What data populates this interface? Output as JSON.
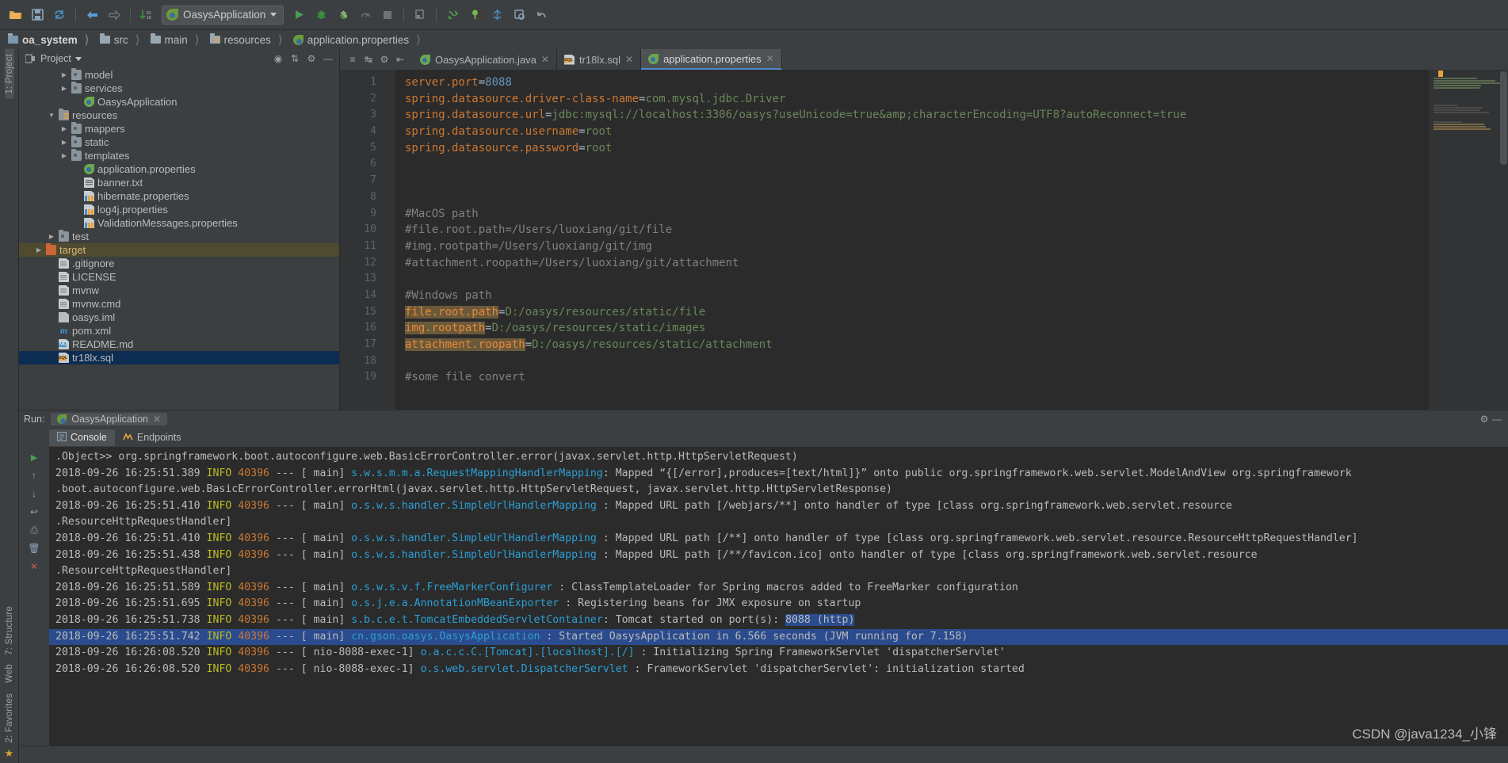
{
  "toolbar": {
    "icons": [
      "open-folder-icon",
      "save-icon",
      "sync-icon",
      "back-arrow-icon",
      "forward-arrow-icon",
      "update-icon"
    ],
    "run_config": "OasysApplication",
    "right_icons": [
      "run-icon",
      "debug-icon",
      "run-coverage-icon",
      "profile-icon",
      "stop-icon",
      "build-icon",
      "vcs-update-icon",
      "vcs-commit-icon",
      "vcs-merge-icon",
      "search-everywhere-icon",
      "settings-icon",
      "undo-icon"
    ]
  },
  "breadcrumb": [
    "oa_system",
    "src",
    "main",
    "resources",
    "application.properties"
  ],
  "project_panel": {
    "title": "Project",
    "tools": [
      "target-icon",
      "collapse-icon",
      "settings-icon",
      "hide-icon"
    ],
    "items": [
      {
        "label": "model",
        "indent": 3,
        "arrow": "▶",
        "icon": "folder-icon"
      },
      {
        "label": "services",
        "indent": 3,
        "arrow": "▶",
        "icon": "folder-icon"
      },
      {
        "label": "OasysApplication",
        "indent": 4,
        "arrow": "",
        "icon": "spring-class-icon"
      },
      {
        "label": "resources",
        "indent": 2,
        "arrow": "▼",
        "icon": "resources-folder-icon"
      },
      {
        "label": "mappers",
        "indent": 3,
        "arrow": "▶",
        "icon": "folder-icon"
      },
      {
        "label": "static",
        "indent": 3,
        "arrow": "▶",
        "icon": "folder-icon"
      },
      {
        "label": "templates",
        "indent": 3,
        "arrow": "▶",
        "icon": "folder-icon"
      },
      {
        "label": "application.properties",
        "indent": 4,
        "arrow": "",
        "icon": "spring-properties-icon"
      },
      {
        "label": "banner.txt",
        "indent": 4,
        "arrow": "",
        "icon": "text-file-icon"
      },
      {
        "label": "hibernate.properties",
        "indent": 4,
        "arrow": "",
        "icon": "properties-file-icon"
      },
      {
        "label": "log4j.properties",
        "indent": 4,
        "arrow": "",
        "icon": "properties-file-icon"
      },
      {
        "label": "ValidationMessages.properties",
        "indent": 4,
        "arrow": "",
        "icon": "properties-file-icon"
      },
      {
        "label": "test",
        "indent": 2,
        "arrow": "▶",
        "icon": "folder-icon"
      },
      {
        "label": "target",
        "indent": 1,
        "arrow": "▶",
        "icon": "target-folder-icon",
        "state": "highlighted"
      },
      {
        "label": ".gitignore",
        "indent": 2,
        "arrow": "",
        "icon": "file-icon"
      },
      {
        "label": "LICENSE",
        "indent": 2,
        "arrow": "",
        "icon": "file-icon"
      },
      {
        "label": "mvnw",
        "indent": 2,
        "arrow": "",
        "icon": "file-icon"
      },
      {
        "label": "mvnw.cmd",
        "indent": 2,
        "arrow": "",
        "icon": "file-icon"
      },
      {
        "label": "oasys.iml",
        "indent": 2,
        "arrow": "",
        "icon": "iml-file-icon"
      },
      {
        "label": "pom.xml",
        "indent": 2,
        "arrow": "",
        "icon": "maven-file-icon"
      },
      {
        "label": "README.md",
        "indent": 2,
        "arrow": "",
        "icon": "markdown-file-icon"
      },
      {
        "label": "tr18lx.sql",
        "indent": 2,
        "arrow": "",
        "icon": "sql-file-icon",
        "state": "selected"
      }
    ]
  },
  "editor": {
    "tabs": [
      {
        "label": "OasysApplication.java",
        "icon": "spring-class-icon",
        "active": false,
        "closable": true
      },
      {
        "label": "tr18lx.sql",
        "icon": "sql-file-icon",
        "active": false,
        "closable": true
      },
      {
        "label": "application.properties",
        "icon": "spring-properties-icon",
        "active": true,
        "closable": true
      }
    ],
    "lines": [
      {
        "no": 1,
        "parts": [
          {
            "t": "server.port",
            "c": "k"
          },
          {
            "t": "=",
            "c": "eq"
          },
          {
            "t": "8088",
            "c": "n"
          }
        ]
      },
      {
        "no": 2,
        "parts": [
          {
            "t": "spring.datasource.driver-class-name",
            "c": "k"
          },
          {
            "t": "=",
            "c": "eq"
          },
          {
            "t": "com.mysql.jdbc.Driver",
            "c": "v"
          }
        ]
      },
      {
        "no": 3,
        "parts": [
          {
            "t": "spring.datasource.url",
            "c": "k"
          },
          {
            "t": "=",
            "c": "eq"
          },
          {
            "t": "jdbc:mysql://localhost:3306/oasys?useUnicode=true&amp;characterEncoding=UTF8?autoReconnect=true",
            "c": "v"
          }
        ]
      },
      {
        "no": 4,
        "parts": [
          {
            "t": "spring.datasource.username",
            "c": "k"
          },
          {
            "t": "=",
            "c": "eq"
          },
          {
            "t": "root",
            "c": "v"
          }
        ]
      },
      {
        "no": 5,
        "parts": [
          {
            "t": "spring.datasource.password",
            "c": "k"
          },
          {
            "t": "=",
            "c": "eq"
          },
          {
            "t": "root",
            "c": "v"
          }
        ]
      },
      {
        "no": 6,
        "parts": []
      },
      {
        "no": 7,
        "parts": []
      },
      {
        "no": 8,
        "parts": []
      },
      {
        "no": 9,
        "parts": [
          {
            "t": "#MacOS path",
            "c": "cm"
          }
        ]
      },
      {
        "no": 10,
        "parts": [
          {
            "t": "#file.root.path=/Users/luoxiang/git/file",
            "c": "cm"
          }
        ]
      },
      {
        "no": 11,
        "parts": [
          {
            "t": "#img.rootpath=/Users/luoxiang/git/img",
            "c": "cm"
          }
        ]
      },
      {
        "no": 12,
        "parts": [
          {
            "t": "#attachment.roopath=/Users/luoxiang/git/attachment",
            "c": "cm"
          }
        ]
      },
      {
        "no": 13,
        "parts": []
      },
      {
        "no": 14,
        "parts": [
          {
            "t": "#Windows path",
            "c": "cm"
          }
        ]
      },
      {
        "no": 15,
        "parts": [
          {
            "t": "file.root.path",
            "c": "hlk"
          },
          {
            "t": "=",
            "c": "eq"
          },
          {
            "t": "D:/oasys/resources/static/file",
            "c": "v"
          }
        ]
      },
      {
        "no": 16,
        "parts": [
          {
            "t": "img.rootpath",
            "c": "hlk"
          },
          {
            "t": "=",
            "c": "eq"
          },
          {
            "t": "D:/oasys/resources/static/images",
            "c": "v"
          }
        ]
      },
      {
        "no": 17,
        "parts": [
          {
            "t": "attachment.roopath",
            "c": "hlk"
          },
          {
            "t": "=",
            "c": "eq"
          },
          {
            "t": "D:/oasys/resources/static/attachment",
            "c": "v"
          }
        ]
      },
      {
        "no": 18,
        "parts": []
      },
      {
        "no": 19,
        "parts": [
          {
            "t": "#some file convert",
            "c": "cm"
          }
        ]
      }
    ]
  },
  "run_panel": {
    "label": "Run:",
    "tab": "OasysApplication",
    "subtabs": [
      {
        "label": "Console",
        "icon": "console-icon",
        "active": true
      },
      {
        "label": "Endpoints",
        "icon": "endpoints-icon",
        "active": false
      }
    ],
    "gutter_icons": [
      "rerun-icon",
      "scroll-up-icon",
      "scroll-down-icon",
      "soft-wrap-icon",
      "print-icon",
      "clear-all-icon",
      "close-icon"
    ],
    "console_lines": [
      {
        "type": "cont",
        "text": ".Object>> org.springframework.boot.autoconfigure.web.BasicErrorController.error(javax.servlet.http.HttpServletRequest)"
      },
      {
        "type": "log",
        "ts": "2018-09-26 16:25:51.389",
        "level": "INFO",
        "pid": "40396",
        "thread": "main",
        "logger": "s.w.s.m.m.a.RequestMappingHandlerMapping",
        "msg": ": Mapped “{[/error],produces=[text/html]}” onto public org.springframework.web.servlet.ModelAndView org.springframework"
      },
      {
        "type": "cont",
        "text": ".boot.autoconfigure.web.BasicErrorController.errorHtml(javax.servlet.http.HttpServletRequest, javax.servlet.http.HttpServletResponse)"
      },
      {
        "type": "log",
        "ts": "2018-09-26 16:25:51.410",
        "level": "INFO",
        "pid": "40396",
        "thread": "main",
        "logger": "o.s.w.s.handler.SimpleUrlHandlerMapping",
        "msg": ": Mapped URL path [/webjars/**] onto handler of type [class org.springframework.web.servlet.resource"
      },
      {
        "type": "cont",
        "text": ".ResourceHttpRequestHandler]"
      },
      {
        "type": "log",
        "ts": "2018-09-26 16:25:51.410",
        "level": "INFO",
        "pid": "40396",
        "thread": "main",
        "logger": "o.s.w.s.handler.SimpleUrlHandlerMapping",
        "msg": ": Mapped URL path [/**] onto handler of type [class org.springframework.web.servlet.resource.ResourceHttpRequestHandler]"
      },
      {
        "type": "log",
        "ts": "2018-09-26 16:25:51.438",
        "level": "INFO",
        "pid": "40396",
        "thread": "main",
        "logger": "o.s.w.s.handler.SimpleUrlHandlerMapping",
        "msg": ": Mapped URL path [/**/favicon.ico] onto handler of type [class org.springframework.web.servlet.resource"
      },
      {
        "type": "cont",
        "text": ".ResourceHttpRequestHandler]"
      },
      {
        "type": "log",
        "ts": "2018-09-26 16:25:51.589",
        "level": "INFO",
        "pid": "40396",
        "thread": "main",
        "logger": "o.s.w.s.v.f.FreeMarkerConfigurer",
        "msg": ": ClassTemplateLoader for Spring macros added to FreeMarker configuration"
      },
      {
        "type": "log",
        "ts": "2018-09-26 16:25:51.695",
        "level": "INFO",
        "pid": "40396",
        "thread": "main",
        "logger": "o.s.j.e.a.AnnotationMBeanExporter",
        "msg": ": Registering beans for JMX exposure on startup"
      },
      {
        "type": "log",
        "ts": "2018-09-26 16:25:51.738",
        "level": "INFO",
        "pid": "40396",
        "thread": "main",
        "logger": "s.b.c.e.t.TomcatEmbeddedServletContainer",
        "msg": ": Tomcat started on port(s): ",
        "sel_msg": "8088 (http)"
      },
      {
        "type": "log",
        "ts": "2018-09-26 16:25:51.742",
        "level": "INFO",
        "pid": "40396",
        "thread": "main",
        "logger": "cn.gson.oasys.OasysApplication",
        "msg": ": Started OasysApplication in 6.566 seconds (JVM running",
        "msg_tail": " for 7.158)",
        "selected": true
      },
      {
        "type": "log",
        "ts": "2018-09-26 16:26:08.520",
        "level": "INFO",
        "pid": "40396",
        "thread": "nio-8088-exec-1",
        "logger": "o.a.c.c.C.[Tomcat].[localhost].[/]",
        "msg": ": Initializing Spring FrameworkServlet 'dispatcherServlet'"
      },
      {
        "type": "log",
        "ts": "2018-09-26 16:26:08.520",
        "level": "INFO",
        "pid": "40396",
        "thread": "nio-8088-exec-1",
        "logger": "o.s.web.servlet.DispatcherServlet",
        "msg": ": FrameworkServlet 'dispatcherServlet': initialization started"
      }
    ]
  },
  "left_tool_buttons": [
    {
      "label": "1: Project",
      "icon": "project-icon",
      "active": true
    },
    {
      "label": "7: Structure",
      "icon": "structure-icon",
      "active": false
    },
    {
      "label": "Web",
      "icon": "web-icon",
      "active": false
    },
    {
      "label": "2: Favorites",
      "icon": "favorites-icon",
      "active": false
    }
  ],
  "watermark": "CSDN @java1234_小锋",
  "colors": {
    "accent": "#4a88c7",
    "selection": "#2a4b8d",
    "tree_selection": "#0d2c52",
    "key": "#cc7832",
    "value": "#6a8759",
    "number": "#6897bb",
    "comment": "#808080",
    "info_level": "#bbbb23",
    "pid": "#cc7832",
    "logger": "#287bde",
    "editor_bg": "#2b2b2b",
    "panel_bg": "#3c3f41"
  }
}
